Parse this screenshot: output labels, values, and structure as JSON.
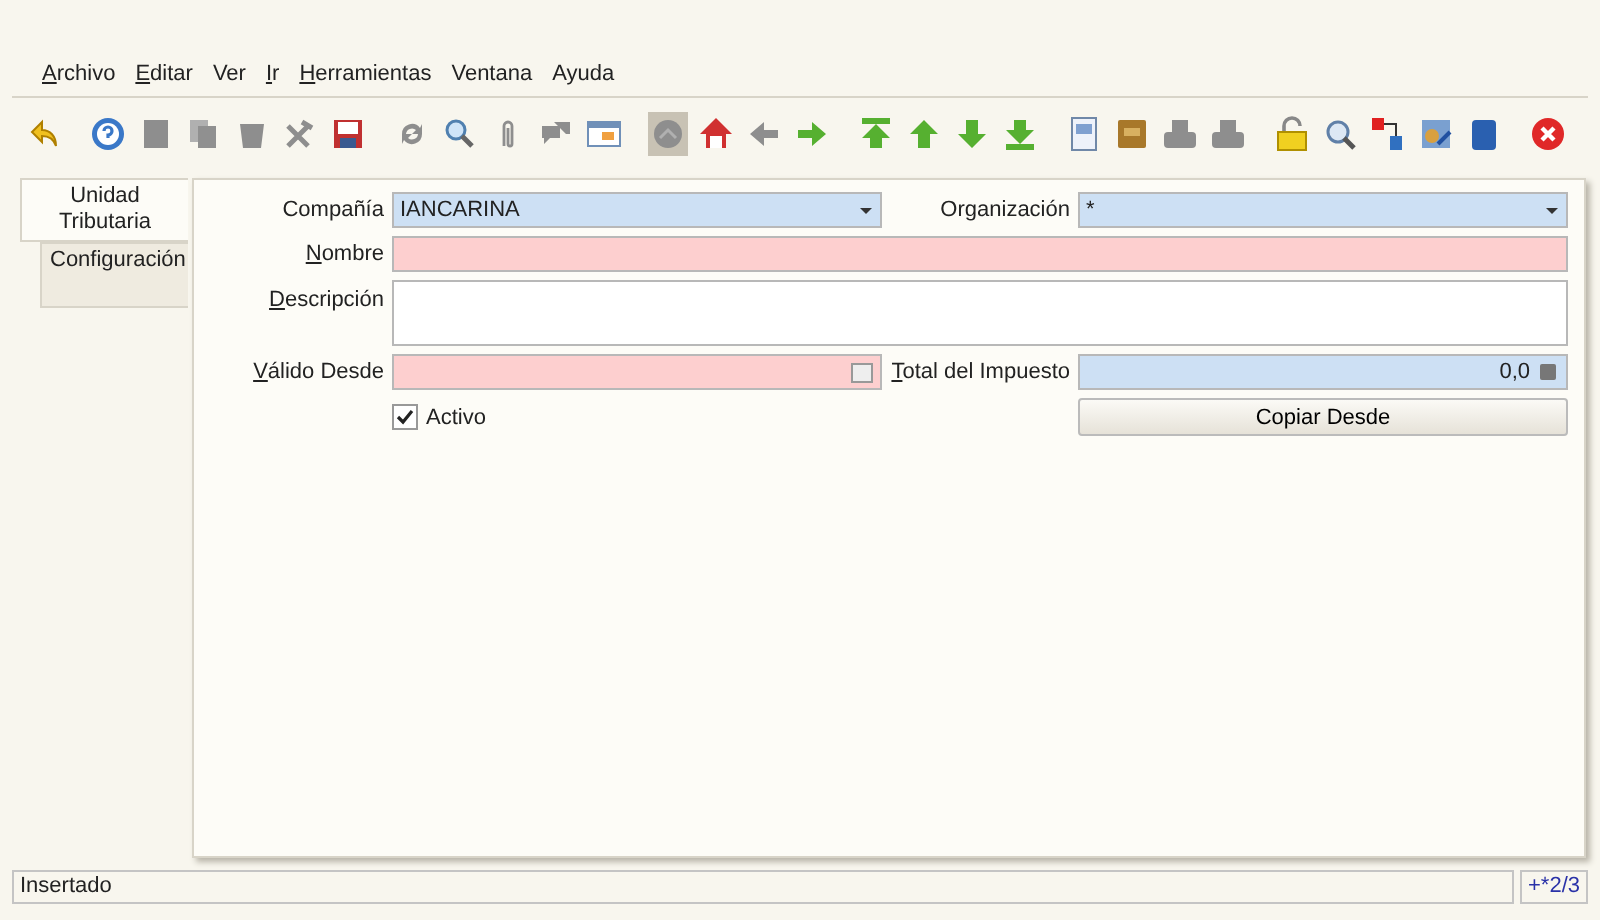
{
  "menu": [
    {
      "label": "Archivo",
      "mnemonic": true
    },
    {
      "label": "Editar",
      "mnemonic": true
    },
    {
      "label": "Ver",
      "mnemonic": false
    },
    {
      "label": "Ir",
      "mnemonic": true
    },
    {
      "label": "Herramientas",
      "mnemonic": true
    },
    {
      "label": "Ventana",
      "mnemonic": false
    },
    {
      "label": "Ayuda",
      "mnemonic": false
    }
  ],
  "tabs": [
    {
      "label": "Unidad Tributaria",
      "selected": true
    },
    {
      "label": "Configuración",
      "selected": false
    }
  ],
  "form": {
    "company": {
      "label": "Compañía",
      "value": "IANCARINA"
    },
    "organization": {
      "label": "Organización",
      "value": "*"
    },
    "name": {
      "label": "Nombre",
      "mnemonic": true
    },
    "description": {
      "label": "Descripción",
      "mnemonic": true
    },
    "valid_from": {
      "label": "Válido Desde",
      "mnemonic": true
    },
    "tax_total": {
      "label": "Total del Impuesto",
      "mnemonic": true,
      "value": "0,0"
    },
    "active": {
      "label": "Activo",
      "checked": true
    },
    "copy_button": "Copiar Desde"
  },
  "status_bar": {
    "message": "Insertado",
    "record": "+*2/3"
  }
}
